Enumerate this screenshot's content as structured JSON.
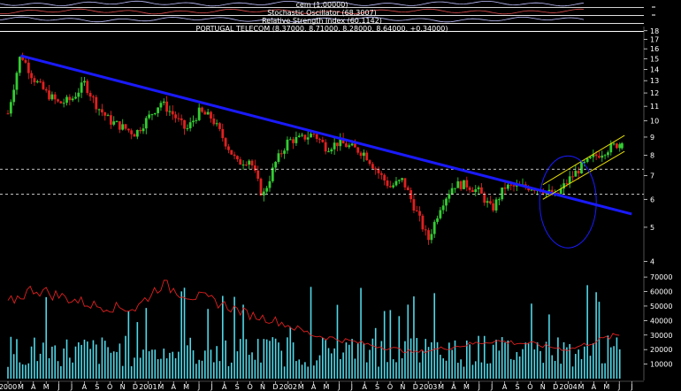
{
  "header": {
    "line1": "cem (1.00000)",
    "line2": "Stochastic Oscillator (68.3007)",
    "line3": "Relative Strength Index (60.1142)",
    "line4": "PORTUGAL TELECOM (8.37000, 8.71000, 8.28000, 8.64000, +0.34000)"
  },
  "colors": {
    "background": "#000000",
    "up_candle": "#33cc33",
    "down_candle": "#e02020",
    "trendline": "#1a1aff",
    "channel": "#e8e000",
    "volume": "#4fd8e8",
    "volume_line": "#e02020",
    "axis_text": "#ffffff",
    "support": "#ffffff",
    "ellipse": "#1a1aff"
  },
  "chart_data": {
    "type": "candlestick",
    "instrument": "PORTUGAL TELECOM",
    "last": {
      "open": 8.37,
      "high": 8.71,
      "low": 8.28,
      "close": 8.64,
      "change": 0.34
    },
    "price_axis": {
      "scale": "log",
      "range": [
        3.9,
        18.5
      ],
      "ticks": [
        18,
        17,
        16,
        15,
        14,
        13,
        12,
        11,
        10,
        9,
        8,
        7,
        6,
        5,
        4
      ]
    },
    "volume_axis": {
      "range": [
        0,
        78000
      ],
      "ticks": [
        70000,
        60000,
        50000,
        40000,
        30000,
        20000,
        10000
      ],
      "tick_labels": [
        "70000",
        "60000",
        "50000",
        "40000",
        "30000",
        "20000",
        "10000"
      ]
    },
    "time_axis": {
      "start": "2000-01",
      "months": [
        "2000",
        "M",
        "A",
        "M",
        "J",
        "J",
        "A",
        "S",
        "O",
        "N",
        "D",
        "2001",
        "M",
        "A",
        "M",
        "J",
        "J",
        "A",
        "S",
        "O",
        "N",
        "D",
        "2002",
        "M",
        "A",
        "M",
        "J",
        "J",
        "A",
        "S",
        "O",
        "N",
        "D",
        "2003",
        "M",
        "A",
        "M",
        "J",
        "J",
        "A",
        "S",
        "O",
        "N",
        "D",
        "2004",
        "M",
        "A",
        "M",
        "J",
        "J"
      ]
    },
    "price_path": [
      [
        "2000-01",
        10.5
      ],
      [
        "2000-02",
        15.5
      ],
      [
        "2000-03",
        13.2
      ],
      [
        "2000-04",
        12.0
      ],
      [
        "2000-05",
        11.2
      ],
      [
        "2000-06",
        11.5
      ],
      [
        "2000-07",
        12.8
      ],
      [
        "2000-08",
        11.0
      ],
      [
        "2000-09",
        10.0
      ],
      [
        "2000-10",
        9.6
      ],
      [
        "2000-11",
        9.2
      ],
      [
        "2000-12",
        10.2
      ],
      [
        "2001-01",
        11.3
      ],
      [
        "2001-02",
        10.4
      ],
      [
        "2001-03",
        9.4
      ],
      [
        "2001-04",
        10.6
      ],
      [
        "2001-05",
        10.2
      ],
      [
        "2001-06",
        8.8
      ],
      [
        "2001-07",
        7.6
      ],
      [
        "2001-08",
        7.8
      ],
      [
        "2001-09",
        6.1
      ],
      [
        "2001-10",
        7.6
      ],
      [
        "2001-11",
        8.8
      ],
      [
        "2001-12",
        8.9
      ],
      [
        "2002-01",
        9.2
      ],
      [
        "2002-02",
        8.4
      ],
      [
        "2002-03",
        8.7
      ],
      [
        "2002-04",
        8.4
      ],
      [
        "2002-05",
        8.1
      ],
      [
        "2002-06",
        7.2
      ],
      [
        "2002-07",
        6.5
      ],
      [
        "2002-08",
        6.8
      ],
      [
        "2002-09",
        5.6
      ],
      [
        "2002-10",
        4.6
      ],
      [
        "2002-11",
        5.8
      ],
      [
        "2002-12",
        6.6
      ],
      [
        "2003-01",
        6.6
      ],
      [
        "2003-02",
        6.3
      ],
      [
        "2003-03",
        5.6
      ],
      [
        "2003-04",
        6.5
      ],
      [
        "2003-05",
        6.5
      ],
      [
        "2003-06",
        6.5
      ],
      [
        "2003-07",
        6.4
      ],
      [
        "2003-08",
        6.1
      ],
      [
        "2003-09",
        6.8
      ],
      [
        "2003-10",
        7.4
      ],
      [
        "2003-11",
        7.9
      ],
      [
        "2003-12",
        8.3
      ],
      [
        "2004-01",
        8.64
      ]
    ],
    "volume_ratio_path": [
      [
        "2000-01",
        52000
      ],
      [
        "2000-03",
        62000
      ],
      [
        "2000-05",
        57000
      ],
      [
        "2000-08",
        50000
      ],
      [
        "2000-11",
        48000
      ],
      [
        "2001-01",
        65000
      ],
      [
        "2001-03",
        58000
      ],
      [
        "2001-05",
        54000
      ],
      [
        "2001-08",
        44000
      ],
      [
        "2001-10",
        40000
      ],
      [
        "2002-01",
        30000
      ],
      [
        "2002-05",
        24000
      ],
      [
        "2002-09",
        18000
      ],
      [
        "2002-12",
        22000
      ],
      [
        "2003-03",
        26000
      ],
      [
        "2003-06",
        24000
      ],
      [
        "2003-09",
        20000
      ],
      [
        "2003-12",
        28000
      ],
      [
        "2004-01",
        30000
      ]
    ],
    "annotations": {
      "trendline": {
        "from": [
          "2000-02",
          15.3
        ],
        "to": [
          "2004-01",
          5.45
        ]
      },
      "support_levels": [
        7.3,
        6.2
      ],
      "channel": {
        "lower_from": [
          "2003-07",
          6.0
        ],
        "lower_to": [
          "2004-01",
          8.2
        ],
        "upper_from": [
          "2003-07",
          6.6
        ],
        "upper_to": [
          "2004-01",
          9.1
        ]
      },
      "ellipse_center": [
        "2003-08",
        5.9
      ]
    }
  }
}
